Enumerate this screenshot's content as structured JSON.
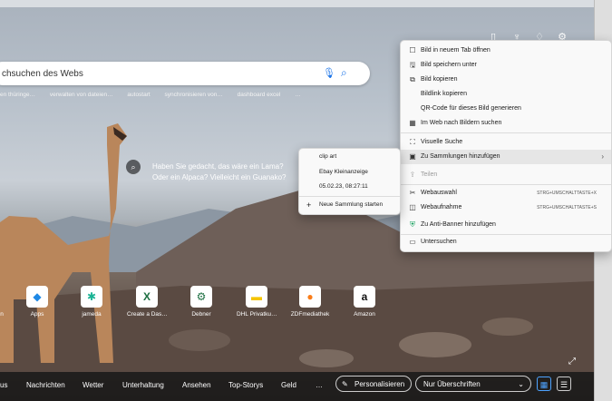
{
  "search": {
    "placeholder": "chsuchen des Webs"
  },
  "suggestions": [
    "en thüringe…",
    "verwalten von dateien…",
    "autostart",
    "synchronisieren von…",
    "dashboard excel",
    "…"
  ],
  "hero": {
    "line1": "Haben Sie gedacht, das wäre ein Lama?",
    "line2": "Oder ein Alpaca? Vielleicht ein Guanako?"
  },
  "tiles": [
    {
      "label": "n",
      "glyph": ""
    },
    {
      "label": "Apps",
      "glyph": "◆",
      "color": "#1e88e5"
    },
    {
      "label": "jameda",
      "glyph": "✱",
      "color": "#1ab394"
    },
    {
      "label": "Create a Das…",
      "glyph": "X",
      "color": "#1d6f42"
    },
    {
      "label": "Debner",
      "glyph": "⚙",
      "color": "#1d6f42"
    },
    {
      "label": "DHL Privatku…",
      "glyph": "▬",
      "color": "#f5c400"
    },
    {
      "label": "ZDFmediathek",
      "glyph": "●",
      "color": "#fa7d19"
    },
    {
      "label": "Amazon",
      "glyph": "a",
      "color": "#111"
    }
  ],
  "bottom_nav": [
    "us",
    "Nachrichten",
    "Wetter",
    "Unterhaltung",
    "Ansehen",
    "Top-Storys",
    "Geld",
    "…"
  ],
  "personalize_label": "Personalisieren",
  "layout_select": "Nur Überschriften",
  "context_menu": {
    "items": [
      {
        "icon": "☐",
        "label": "Bild in neuem Tab öffnen",
        "shortcut": ""
      },
      {
        "icon": "🖫",
        "label": "Bild speichern unter",
        "shortcut": ""
      },
      {
        "icon": "⧉",
        "label": "Bild kopieren",
        "shortcut": ""
      },
      {
        "icon": "",
        "label": "Bildlink kopieren",
        "shortcut": ""
      },
      {
        "icon": "",
        "label": "QR-Code für dieses Bild generieren",
        "shortcut": ""
      },
      {
        "icon": "▦",
        "label": "Im Web nach Bildern suchen",
        "shortcut": ""
      },
      {
        "icon": "⛶",
        "label": "Visuelle Suche",
        "shortcut": ""
      },
      {
        "icon": "▣",
        "label": "Zu Sammlungen hinzufügen",
        "shortcut": "",
        "arrow": "›"
      },
      {
        "icon": "⇪",
        "label": "Teilen",
        "shortcut": ""
      },
      {
        "icon": "✂",
        "label": "Webauswahl",
        "shortcut": "STRG+UMSCHALTTASTE+X"
      },
      {
        "icon": "◫",
        "label": "Webaufnahme",
        "shortcut": "STRG+UMSCHALTTASTE+S"
      },
      {
        "icon": "⛨",
        "label": "Zu Anti-Banner hinzufügen",
        "shortcut": ""
      },
      {
        "icon": "▭",
        "label": "Untersuchen",
        "shortcut": ""
      }
    ]
  },
  "submenu": {
    "items": [
      "clip art",
      "Ebay Kleinanzeige",
      "05.02.23, 08:27:11"
    ],
    "new_label": "Neue Sammlung starten"
  }
}
